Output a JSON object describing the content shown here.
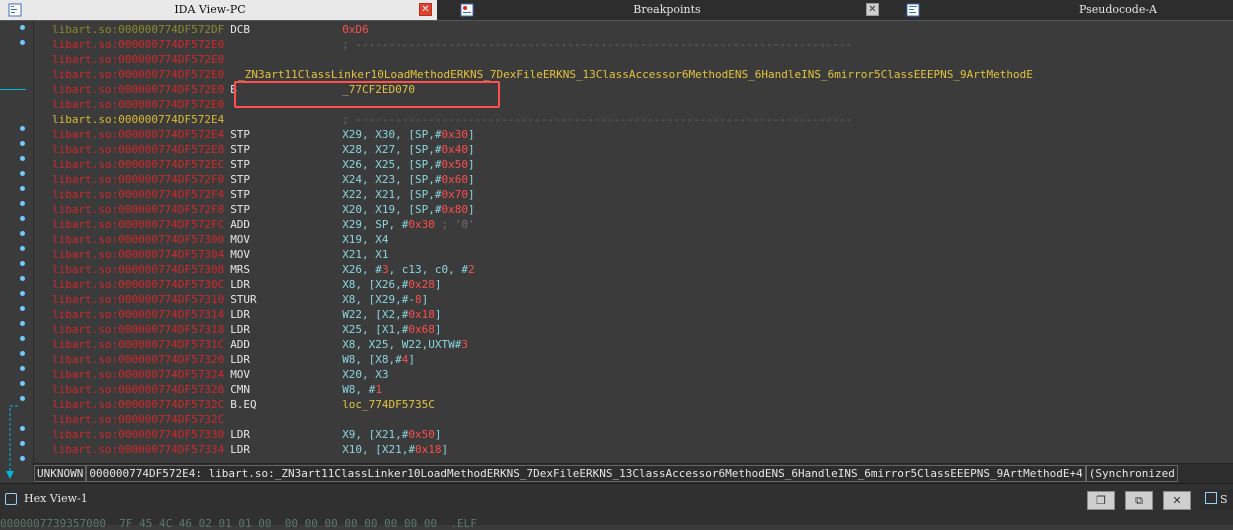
{
  "tabs": [
    {
      "label": "IDA View-PC",
      "active": true,
      "icon": "ida-view-icon"
    },
    {
      "label": "Breakpoints",
      "active": false,
      "icon": "breakpoints-icon"
    },
    {
      "label": "Pseudocode-A",
      "active": false,
      "icon": "pseudocode-icon"
    }
  ],
  "tab_close_glyph": "✕",
  "listing": {
    "lines": [
      {
        "addr": "libart.so:000000774DF572DF",
        "mn": "DCB",
        "ops": "0xD6",
        "addr_color": "g",
        "op_type": "num"
      },
      {
        "addr": "libart.so:000000774DF572E0",
        "mn": "",
        "ops": "; ---------------------------------------------------------------------------",
        "addr_color": "r",
        "op_type": "sep"
      },
      {
        "addr": "libart.so:000000774DF572E0",
        "mn": "",
        "ops": "",
        "addr_color": "r",
        "op_type": "op"
      },
      {
        "addr": "libart.so:000000774DF572E0",
        "mn": "_ZN3art11ClassLinker10LoadMethodERKNS_7DexFileERKNS_13ClassAccessor6MethodENS_6HandleINS_6mirror5ClassEEEPNS_9ArtMethodE",
        "ops": "",
        "addr_color": "r",
        "op_type": "sym"
      },
      {
        "addr": "libart.so:000000774DF572E0",
        "mn": "B",
        "ops": "_77CF2ED070",
        "addr_color": "r",
        "op_type": "sym"
      },
      {
        "addr": "libart.so:000000774DF572E0",
        "mn": "",
        "ops": "",
        "addr_color": "r",
        "op_type": "op"
      },
      {
        "addr": "libart.so:000000774DF572E4",
        "mn": "",
        "ops": "; ---------------------------------------------------------------------------",
        "addr_color": "y",
        "op_type": "sep"
      },
      {
        "addr": "libart.so:000000774DF572E4",
        "mn": "STP",
        "ops": "X29, X30, [SP,#0x30]",
        "addr_color": "r",
        "op_type": "op"
      },
      {
        "addr": "libart.so:000000774DF572E8",
        "mn": "STP",
        "ops": "X28, X27, [SP,#0x40]",
        "addr_color": "r",
        "op_type": "op"
      },
      {
        "addr": "libart.so:000000774DF572EC",
        "mn": "STP",
        "ops": "X26, X25, [SP,#0x50]",
        "addr_color": "r",
        "op_type": "op"
      },
      {
        "addr": "libart.so:000000774DF572F0",
        "mn": "STP",
        "ops": "X24, X23, [SP,#0x60]",
        "addr_color": "r",
        "op_type": "op"
      },
      {
        "addr": "libart.so:000000774DF572F4",
        "mn": "STP",
        "ops": "X22, X21, [SP,#0x70]",
        "addr_color": "r",
        "op_type": "op"
      },
      {
        "addr": "libart.so:000000774DF572F8",
        "mn": "STP",
        "ops": "X20, X19, [SP,#0x80]",
        "addr_color": "r",
        "op_type": "op"
      },
      {
        "addr": "libart.so:000000774DF572FC",
        "mn": "ADD",
        "ops": "X29, SP, #0x30 ; '0'",
        "addr_color": "r",
        "op_type": "op"
      },
      {
        "addr": "libart.so:000000774DF57300",
        "mn": "MOV",
        "ops": "X19, X4",
        "addr_color": "r",
        "op_type": "op"
      },
      {
        "addr": "libart.so:000000774DF57304",
        "mn": "MOV",
        "ops": "X21, X1",
        "addr_color": "r",
        "op_type": "op"
      },
      {
        "addr": "libart.so:000000774DF57308",
        "mn": "MRS",
        "ops": "X26, #3, c13, c0, #2",
        "addr_color": "r",
        "op_type": "op"
      },
      {
        "addr": "libart.so:000000774DF5730C",
        "mn": "LDR",
        "ops": "X8, [X26,#0x28]",
        "addr_color": "r",
        "op_type": "op"
      },
      {
        "addr": "libart.so:000000774DF57310",
        "mn": "STUR",
        "ops": "X8, [X29,#-8]",
        "addr_color": "r",
        "op_type": "op"
      },
      {
        "addr": "libart.so:000000774DF57314",
        "mn": "LDR",
        "ops": "W22, [X2,#0x18]",
        "addr_color": "r",
        "op_type": "op"
      },
      {
        "addr": "libart.so:000000774DF57318",
        "mn": "LDR",
        "ops": "X25, [X1,#0x68]",
        "addr_color": "r",
        "op_type": "op"
      },
      {
        "addr": "libart.so:000000774DF5731C",
        "mn": "ADD",
        "ops": "X8, X25, W22,UXTW#3",
        "addr_color": "r",
        "op_type": "op"
      },
      {
        "addr": "libart.so:000000774DF57320",
        "mn": "LDR",
        "ops": "W8, [X8,#4]",
        "addr_color": "r",
        "op_type": "op"
      },
      {
        "addr": "libart.so:000000774DF57324",
        "mn": "MOV",
        "ops": "X20, X3",
        "addr_color": "r",
        "op_type": "op"
      },
      {
        "addr": "libart.so:000000774DF57328",
        "mn": "CMN",
        "ops": "W8, #1",
        "addr_color": "r",
        "op_type": "op"
      },
      {
        "addr": "libart.so:000000774DF5732C",
        "mn": "B.EQ",
        "ops": "loc_774DF5735C",
        "addr_color": "r",
        "op_type": "sym"
      },
      {
        "addr": "libart.so:000000774DF5732C",
        "mn": "",
        "ops": "",
        "addr_color": "r",
        "op_type": "op"
      },
      {
        "addr": "libart.so:000000774DF57330",
        "mn": "LDR",
        "ops": "X9, [X21,#0x50]",
        "addr_color": "r",
        "op_type": "op"
      },
      {
        "addr": "libart.so:000000774DF57334",
        "mn": "LDR",
        "ops": "X10, [X21,#0x18]",
        "addr_color": "r",
        "op_type": "op"
      }
    ]
  },
  "statusbar": {
    "mode": "UNKNOWN",
    "location": "000000774DF572E4: libart.so:_ZN3art11ClassLinker10LoadMethodERKNS_7DexFileERKNS_13ClassAccessor6MethodENS_6HandleINS_6mirror5ClassEEEPNS_9ArtMethodE+4",
    "sync": "(Synchronized"
  },
  "bottom": {
    "hex_title": "Hex View-1",
    "btn_restore": "❐",
    "btn_float": "⧉",
    "btn_close": "✕",
    "hex_row": "0000007739357000  7F 45 4C 46 02 01 01 00  00 00 00 00 00 00 00 00  .ELF",
    "side_tab": "S"
  },
  "colors": {
    "addr_normal": "#d2282a",
    "addr_current": "#dcb92e",
    "highlight_box": "#ff4f4f",
    "gutter_dot": "#6fcaff"
  }
}
